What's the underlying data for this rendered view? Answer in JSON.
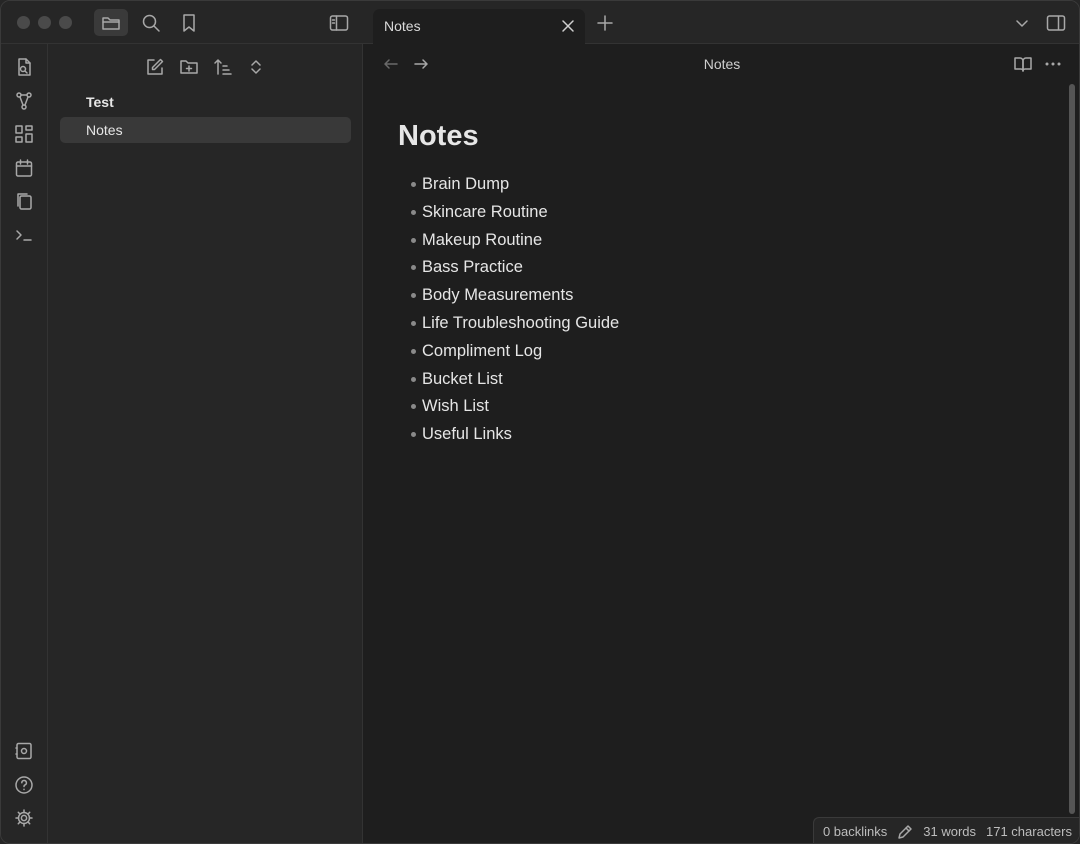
{
  "window": {
    "icons": {
      "files": "folder-icon",
      "search": "search-icon",
      "bookmarks": "bookmark-icon",
      "sidebar_toggle": "sidebar-icon"
    }
  },
  "ribbon": {
    "icons": [
      "open-quick-switcher-icon",
      "graph-view-icon",
      "canvas-icon",
      "daily-note-calendar-icon",
      "templates-icon",
      "command-palette-icon"
    ],
    "bottom_icons": [
      "vault-icon",
      "help-icon",
      "settings-icon"
    ]
  },
  "explorer": {
    "toolbar": [
      "new-note-icon",
      "new-folder-icon",
      "sort-icon",
      "collapse-icon"
    ],
    "folder": "Test",
    "active_file": "Notes"
  },
  "tabs": {
    "items": [
      {
        "label": "Notes",
        "active": true
      }
    ]
  },
  "editor": {
    "view_title": "Notes",
    "title": "Notes",
    "items": [
      "Brain Dump",
      "Skincare Routine",
      "Makeup Routine",
      "Bass Practice",
      "Body Measurements",
      "Life Troubleshooting Guide",
      "Compliment Log",
      "Bucket List",
      "Wish List",
      "Useful Links"
    ]
  },
  "status": {
    "backlinks": "0 backlinks",
    "words": "31 words",
    "characters": "171 characters"
  },
  "colors": {
    "background": "#1e1e1e",
    "sidebar": "#262626",
    "active_item": "#393939",
    "text": "#e6e6e6"
  }
}
